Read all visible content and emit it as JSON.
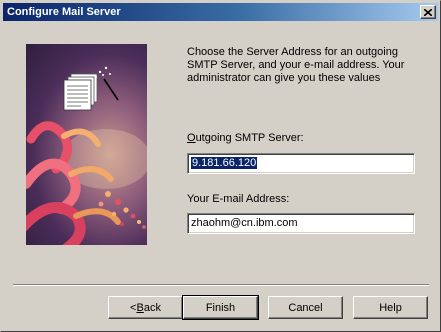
{
  "window": {
    "title": "Configure Mail Server",
    "close_icon": "close-icon"
  },
  "banner": {
    "icon": "address-book-wizard-icon"
  },
  "instructions": "Choose the Server Address for an outgoing SMTP Server, and your e-mail address. Your administrator can give you these values",
  "smtp": {
    "label_accel": "O",
    "label_rest": "utgoing SMTP Server:",
    "value": "9.181.66.120"
  },
  "email": {
    "label": "Your E-mail Address:",
    "value": "zhaohm@cn.ibm.com"
  },
  "buttons": {
    "back_prefix": "< ",
    "back_accel": "B",
    "back_rest": "ack",
    "finish": "Finish",
    "cancel": "Cancel",
    "help": "Help"
  }
}
